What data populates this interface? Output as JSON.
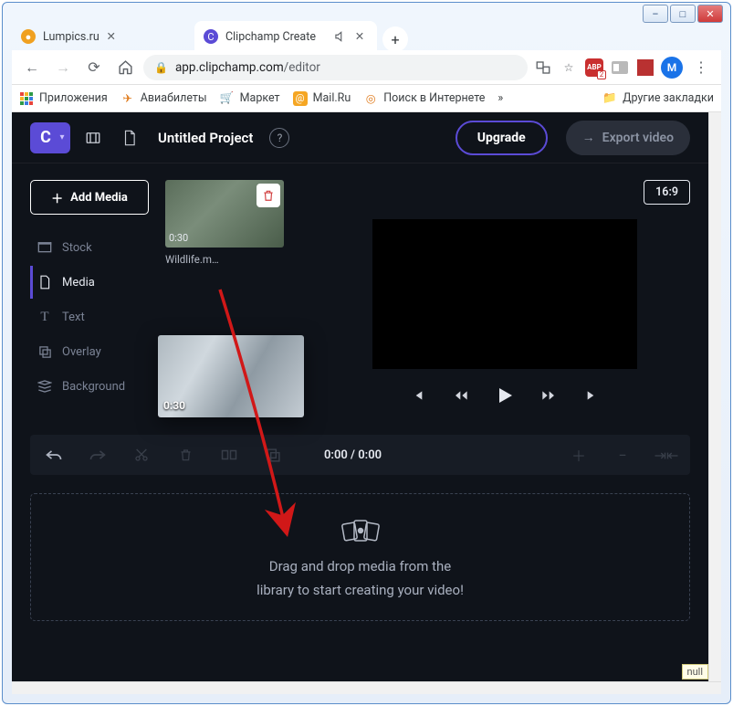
{
  "window": {
    "minimize": "–",
    "maximize": "□",
    "close": "✕"
  },
  "tabs": [
    {
      "title": "Lumpics.ru",
      "active": false,
      "favicon_bg": "#f0a020",
      "favicon_char": "●"
    },
    {
      "title": "Clipchamp Create",
      "active": true,
      "favicon_bg": "#5b4bd6",
      "favicon_char": "C",
      "muted": true
    }
  ],
  "chrome": {
    "url_host": "app.clipchamp.com",
    "url_path": "/editor",
    "translate": "⟳",
    "avatar_letter": "M",
    "adblock": "ABP",
    "adblock_badge": "2"
  },
  "bookmarks": {
    "apps": "Приложения",
    "flights": "Авиабилеты",
    "market": "Маркет",
    "mailru": "Mail.Ru",
    "search": "Поиск в Интернете",
    "more": "»",
    "other": "Другие закладки"
  },
  "header": {
    "logo": "C",
    "title": "Untitled Project",
    "upgrade": "Upgrade",
    "export": "Export video"
  },
  "sidebar": {
    "add_media": "Add Media",
    "items": [
      {
        "label": "Stock"
      },
      {
        "label": "Media"
      },
      {
        "label": "Text"
      },
      {
        "label": "Overlay"
      },
      {
        "label": "Background"
      }
    ],
    "active_index": 1
  },
  "media": {
    "clip": {
      "filename": "Wildlife.m…",
      "duration": "0:30"
    },
    "ghost_duration": "0:30"
  },
  "preview": {
    "aspect": "16:9",
    "time": "0:00 / 0:00"
  },
  "dropzone": {
    "line1": "Drag and drop media from the",
    "line2": "library to start creating your video!"
  },
  "misc": {
    "null_badge": "null"
  }
}
